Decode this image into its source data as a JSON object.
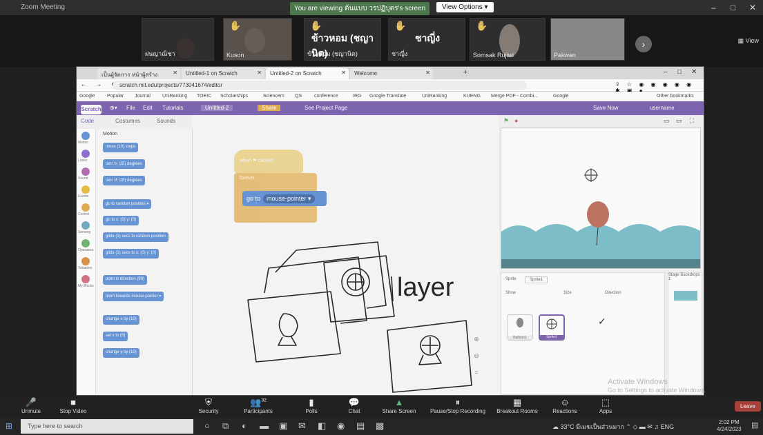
{
  "zoom": {
    "app_title": "Zoom Meeting",
    "viewing_text": "You are viewing ต้นแบบ วรปฏิบุตร's screen",
    "view_options": "View Options ▾",
    "gallery": "View",
    "participants": [
      {
        "name": "ฝนญาณิชา",
        "big": ""
      },
      {
        "name": "Kuson",
        "big": ""
      },
      {
        "name": "ข้าวหอม (ชญานิต)",
        "big": "ข้าวหอม (ชญานิต)",
        "sub": "ข้าวหอม (ชญานิต)"
      },
      {
        "name": "ชาญี่ง",
        "big": "ชาญี่ง",
        "sub": "ชาญี่ง"
      },
      {
        "name": "Somsak Rujiwi",
        "big": ""
      },
      {
        "name": "Pakwan",
        "big": ""
      }
    ],
    "toolbar": [
      {
        "label": "Unmute",
        "icon": "🎤"
      },
      {
        "label": "Stop Video",
        "icon": "■"
      },
      {
        "label": "Security",
        "icon": "⛨"
      },
      {
        "label": "Participants",
        "icon": "👥",
        "count": "32"
      },
      {
        "label": "Polls",
        "icon": "▮"
      },
      {
        "label": "Chat",
        "icon": "💬"
      },
      {
        "label": "Share Screen",
        "icon": "▲"
      },
      {
        "label": "Pause/Stop Recording",
        "icon": "⏸"
      },
      {
        "label": "Breakout Rooms",
        "icon": "▦"
      },
      {
        "label": "Reactions",
        "icon": "☺"
      },
      {
        "label": "Apps",
        "icon": "⬚"
      }
    ],
    "leave": "Leave"
  },
  "browser": {
    "tabs": [
      "เป็นผู้จัดการ หน้าผู้สร้าง",
      "Untitled-1 on Scratch",
      "Untitled-2 on Scratch",
      "Welcome"
    ],
    "url": "scratch.mit.edu/projects/773041674/editor",
    "bookmarks": [
      "Google",
      "Popular",
      "Journal",
      "UniRanking",
      "TOEIC",
      "Scholarships",
      "Sciencem",
      "QS",
      "conference",
      "IRG",
      "Google Translate",
      "UniRanking",
      "KUENG",
      "Merge PDF - Combi...",
      "Google",
      "Other bookmarks"
    ]
  },
  "scratch": {
    "menu": [
      "Scratch",
      "File",
      "Edit",
      "Tutorials",
      "Untitled-2",
      "Share",
      "See Project Page",
      "Save Now",
      "username"
    ],
    "tabs": [
      "Code",
      "Costumes",
      "Sounds"
    ],
    "motion_title": "Motion",
    "categories": [
      "Motion",
      "Looks",
      "Sound",
      "Events",
      "Control",
      "Sensing",
      "Operators",
      "Variables",
      "My Blocks"
    ],
    "palette_blocks": [
      "move (10) steps",
      "turn ↻ (15) degrees",
      "turn ↺ (15) degrees",
      "go to random position ▾",
      "go to x: (0) y: (0)",
      "glide (1) secs to random position",
      "glide (1) secs to x: (0) y: (0)",
      "point in direction (90)",
      "point towards mouse-pointer ▾",
      "change x by (10)",
      "set x to (0)",
      "change y by (10)"
    ],
    "script": {
      "hat": "when ⚑ clicked",
      "forever": "forever",
      "goto": "go to",
      "goto_drop": "mouse-pointer ▾"
    },
    "annotation": "layer",
    "sprite_panel": {
      "sprite_label": "Sprite",
      "sprite_name": "Sprite1",
      "show": "Show",
      "size": "Size",
      "direction": "Direction",
      "sprites": [
        "Balloon1",
        "Sprite1"
      ],
      "stage_label": "Stage",
      "backdrops": "Backdrops",
      "backdrop_count": "1"
    }
  },
  "windows": {
    "activate_title": "Activate Windows",
    "activate_sub": "Go to Settings to activate Windows.",
    "search_placeholder": "Type here to search",
    "weather": "33°C มีเมฆเป็นส่วนมาก",
    "time": "2:02 PM",
    "date": "4/24/2023"
  }
}
